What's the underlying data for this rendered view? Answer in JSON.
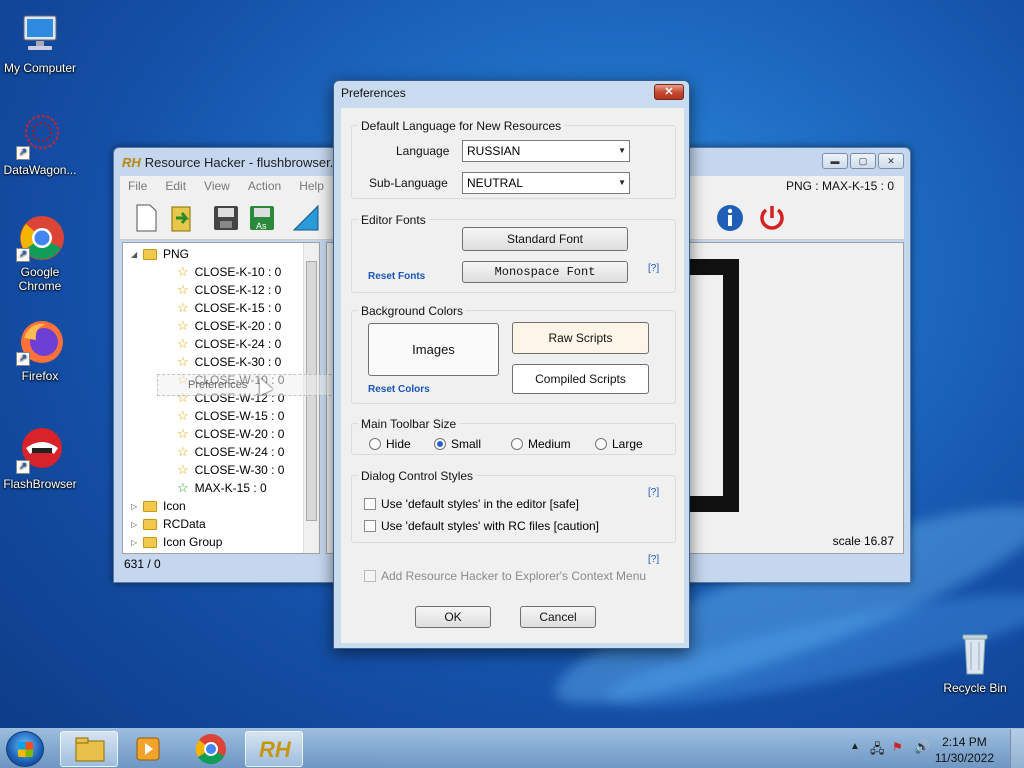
{
  "desktop": {
    "icons": [
      {
        "label": "My Computer"
      },
      {
        "label": "DataWagon..."
      },
      {
        "label": "Google Chrome"
      },
      {
        "label": "Firefox"
      },
      {
        "label": "FlashBrowser"
      },
      {
        "label": "Recycle Bin"
      }
    ]
  },
  "rh_window": {
    "title": "Resource Hacker - flushbrowser.dll",
    "logo": "RH",
    "menu": [
      "File",
      "Edit",
      "View",
      "Action",
      "Help"
    ],
    "resource_info": "PNG : MAX-K-15 : 0",
    "tree": {
      "root": "PNG",
      "items": [
        "CLOSE-K-10 : 0",
        "CLOSE-K-12 : 0",
        "CLOSE-K-15 : 0",
        "CLOSE-K-20 : 0",
        "CLOSE-K-24 : 0",
        "CLOSE-K-30 : 0",
        "CLOSE-W-10 : 0",
        "CLOSE-W-12 : 0",
        "CLOSE-W-15 : 0",
        "CLOSE-W-20 : 0",
        "CLOSE-W-24 : 0",
        "CLOSE-W-30 : 0",
        "MAX-K-15 : 0"
      ],
      "folders": [
        "Icon",
        "RCData",
        "Icon Group"
      ]
    },
    "status_left": "631 / 0",
    "scale": "scale 16.87",
    "drag_ghost": "Preferences"
  },
  "preferences": {
    "title": "Preferences",
    "close_glyph": "✕",
    "default_language": {
      "group_title": "Default Language for New Resources",
      "language_label": "Language",
      "language_value": "RUSSIAN",
      "sublanguage_label": "Sub-Language",
      "sublanguage_value": "NEUTRAL"
    },
    "editor_fonts": {
      "group_title": "Editor Fonts",
      "standard_font": "Standard Font",
      "monospace_font": "Monospace Font",
      "reset": "Reset Fonts",
      "help": "[?]"
    },
    "background_colors": {
      "group_title": "Background Colors",
      "images": "Images",
      "raw_scripts": "Raw Scripts",
      "compiled_scripts": "Compiled Scripts",
      "reset": "Reset Colors"
    },
    "toolbar_size": {
      "group_title": "Main Toolbar Size",
      "options": [
        "Hide",
        "Small",
        "Medium",
        "Large"
      ],
      "selected": "Small"
    },
    "dialog_styles": {
      "group_title": "Dialog Control Styles",
      "help": "[?]",
      "opt_editor": "Use 'default styles' in the editor  [safe]",
      "opt_rc": "Use 'default styles' with RC files  [caution]"
    },
    "context_menu": {
      "help": "[?]",
      "label": "Add Resource Hacker to Explorer's Context Menu"
    },
    "ok": "OK",
    "cancel": "Cancel"
  },
  "taskbar": {
    "time": "2:14 PM",
    "date": "11/30/2022",
    "rh_label": "RH"
  }
}
